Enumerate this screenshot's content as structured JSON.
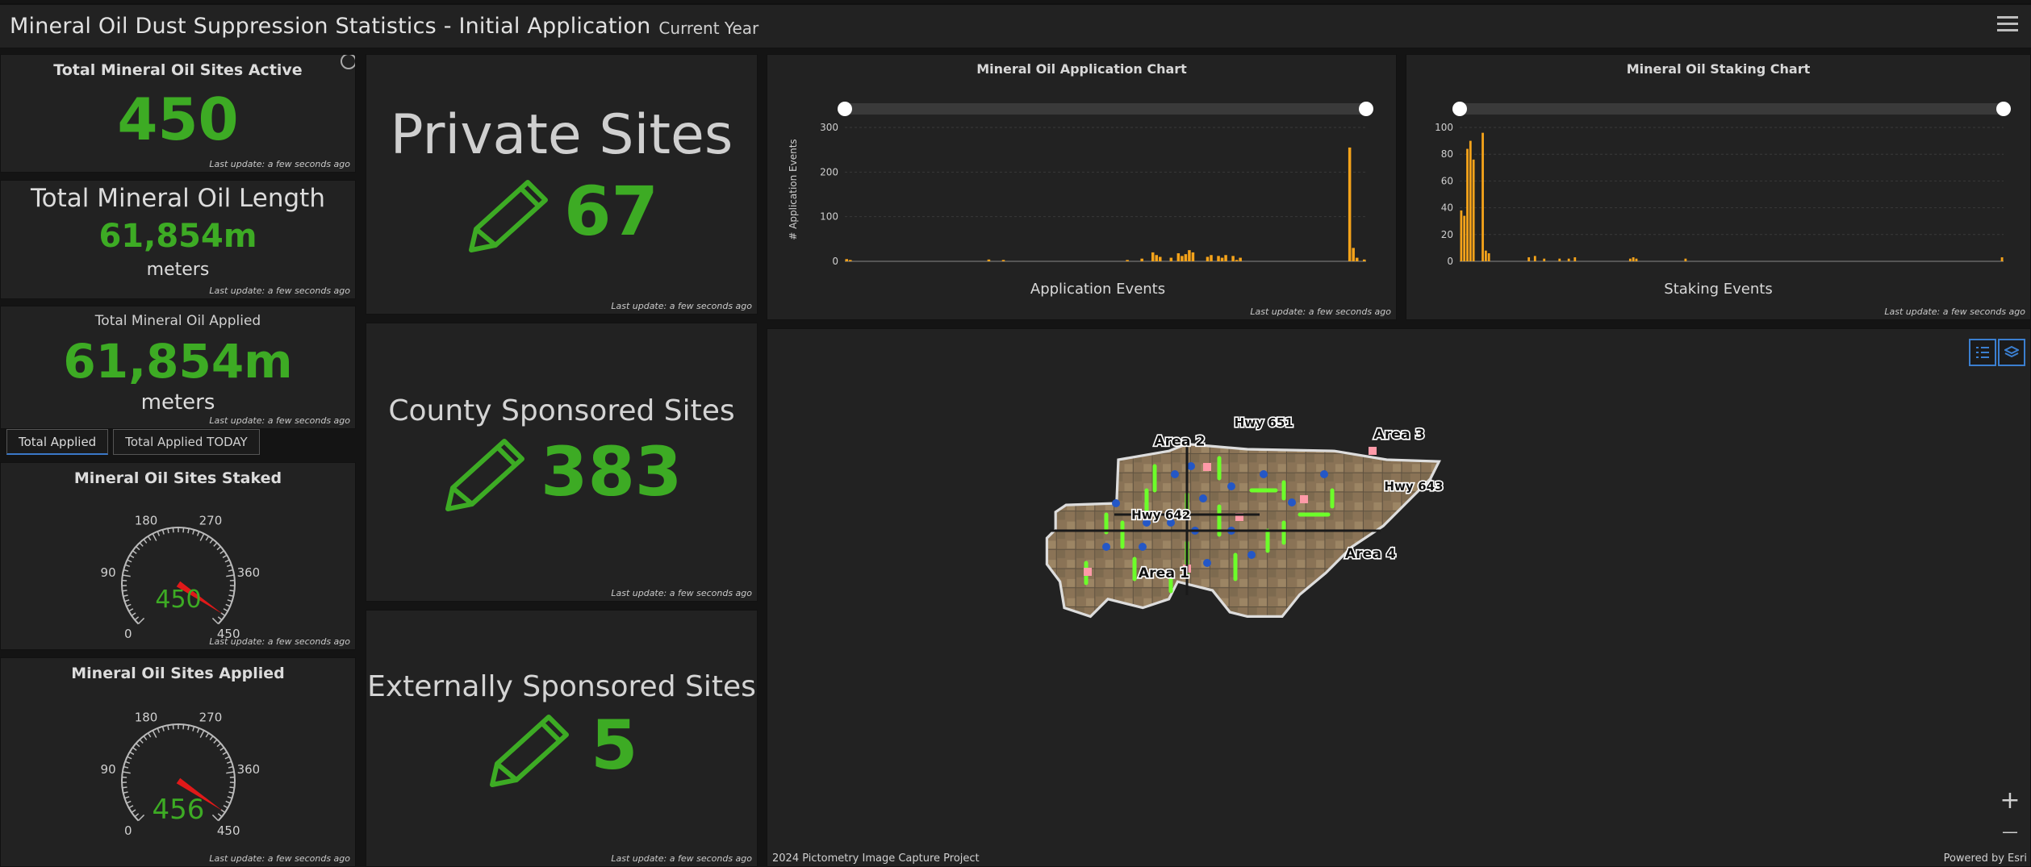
{
  "header": {
    "title": "Mineral Oil Dust Suppression Statistics - Initial Application",
    "subtitle": "Current Year"
  },
  "stamp": "Last update: a few seconds ago",
  "kpi_active": {
    "label": "Total Mineral Oil Sites Active",
    "value": "450"
  },
  "kpi_length": {
    "label": "Total Mineral Oil Length",
    "value": "61,854m",
    "unit": "meters"
  },
  "kpi_applied": {
    "label": "Total Mineral Oil Applied",
    "value": "61,854m",
    "unit": "meters"
  },
  "tabs": [
    "Total Applied",
    "Total Applied TODAY"
  ],
  "gauge_staked": {
    "label": "Mineral Oil Sites Staked",
    "value": "450",
    "value_num": 450,
    "max": 450,
    "ticks": [
      "0",
      "90",
      "180",
      "270",
      "360",
      "450"
    ]
  },
  "gauge_applied": {
    "label": "Mineral Oil Sites Applied",
    "value": "456",
    "value_num": 456,
    "max": 450,
    "ticks": [
      "0",
      "90",
      "180",
      "270",
      "360",
      "450"
    ]
  },
  "private": {
    "label": "Private Sites",
    "value": "67"
  },
  "county": {
    "label": "County Sponsored Sites",
    "value": "383"
  },
  "external": {
    "label": "Externally Sponsored Sites",
    "value": "5"
  },
  "colors": {
    "green": "#3dab24",
    "bar": "#f5a31a",
    "needle": "#e01919",
    "accent": "#3b7fd0"
  },
  "chart_data": [
    {
      "type": "bar",
      "title": "Mineral Oil Application Chart",
      "xlabel": "Application Events",
      "ylabel": "# Application Events",
      "ylim": [
        0,
        300
      ],
      "yticks": [
        "0",
        "100",
        "200",
        "300"
      ],
      "values": [
        5,
        3,
        0,
        0,
        0,
        0,
        0,
        0,
        0,
        0,
        0,
        0,
        0,
        0,
        0,
        0,
        0,
        0,
        0,
        0,
        0,
        0,
        0,
        0,
        0,
        0,
        0,
        0,
        0,
        0,
        0,
        0,
        0,
        0,
        0,
        0,
        0,
        0,
        0,
        4,
        0,
        0,
        0,
        3,
        0,
        0,
        0,
        0,
        0,
        0,
        0,
        0,
        0,
        0,
        0,
        0,
        0,
        0,
        0,
        0,
        0,
        0,
        0,
        0,
        0,
        0,
        0,
        0,
        0,
        0,
        0,
        0,
        0,
        0,
        0,
        0,
        0,
        3,
        0,
        0,
        0,
        6,
        0,
        0,
        20,
        14,
        10,
        0,
        0,
        8,
        0,
        18,
        12,
        16,
        25,
        20,
        0,
        0,
        0,
        10,
        14,
        0,
        12,
        8,
        14,
        0,
        12,
        3,
        8,
        0,
        0,
        0,
        0,
        0,
        0,
        0,
        0,
        0,
        0,
        0,
        0,
        0,
        0,
        0,
        0,
        0,
        0,
        0,
        0,
        0,
        0,
        0,
        0,
        0,
        0,
        0,
        0,
        0,
        255,
        30,
        8,
        0,
        4
      ]
    },
    {
      "type": "bar",
      "title": "Mineral Oil Staking Chart",
      "xlabel": "Staking Events",
      "ylabel": "",
      "ylim": [
        0,
        100
      ],
      "yticks": [
        "0",
        "20",
        "40",
        "60",
        "80",
        "100"
      ],
      "values": [
        38,
        34,
        84,
        90,
        76,
        0,
        0,
        96,
        8,
        6,
        0,
        0,
        0,
        0,
        0,
        0,
        0,
        0,
        0,
        0,
        0,
        0,
        3,
        0,
        4,
        0,
        0,
        2,
        0,
        0,
        0,
        0,
        2,
        0,
        0,
        2,
        0,
        3,
        0,
        0,
        0,
        0,
        0,
        0,
        0,
        0,
        0,
        0,
        0,
        0,
        0,
        0,
        0,
        0,
        0,
        2,
        3,
        2,
        0,
        0,
        0,
        0,
        0,
        0,
        0,
        0,
        0,
        0,
        0,
        0,
        0,
        0,
        0,
        2,
        0,
        0,
        0,
        0,
        0,
        0,
        0,
        0,
        0,
        0,
        0,
        0,
        0,
        0,
        0,
        0,
        0,
        0,
        0,
        0,
        0,
        0,
        0,
        0,
        0,
        0,
        0,
        0,
        0,
        0,
        0,
        0,
        0,
        0,
        0,
        0,
        0,
        0,
        0,
        0,
        0,
        0,
        0,
        0,
        0,
        0,
        0,
        0,
        0,
        0,
        0,
        0,
        0,
        0,
        0,
        0,
        0,
        0,
        0,
        0,
        0,
        0,
        0,
        0,
        0,
        0,
        0,
        0,
        0,
        0,
        0,
        0,
        0,
        0,
        0,
        0,
        0,
        0,
        0,
        0,
        0,
        0,
        0,
        0,
        0,
        0,
        0,
        0,
        0,
        0,
        0,
        0,
        0,
        0,
        0,
        0,
        0,
        0,
        0,
        0,
        0,
        0,
        3
      ]
    }
  ],
  "map": {
    "labels": [
      "Area 1",
      "Area 2",
      "Area 3",
      "Area 4",
      "Hwy 651",
      "Hwy 642",
      "Hwy 643"
    ],
    "attribution": "2024 Pictometry Image Capture Project",
    "powered_by": "Powered by Esri",
    "zoom_in": "+",
    "zoom_out": "—"
  }
}
